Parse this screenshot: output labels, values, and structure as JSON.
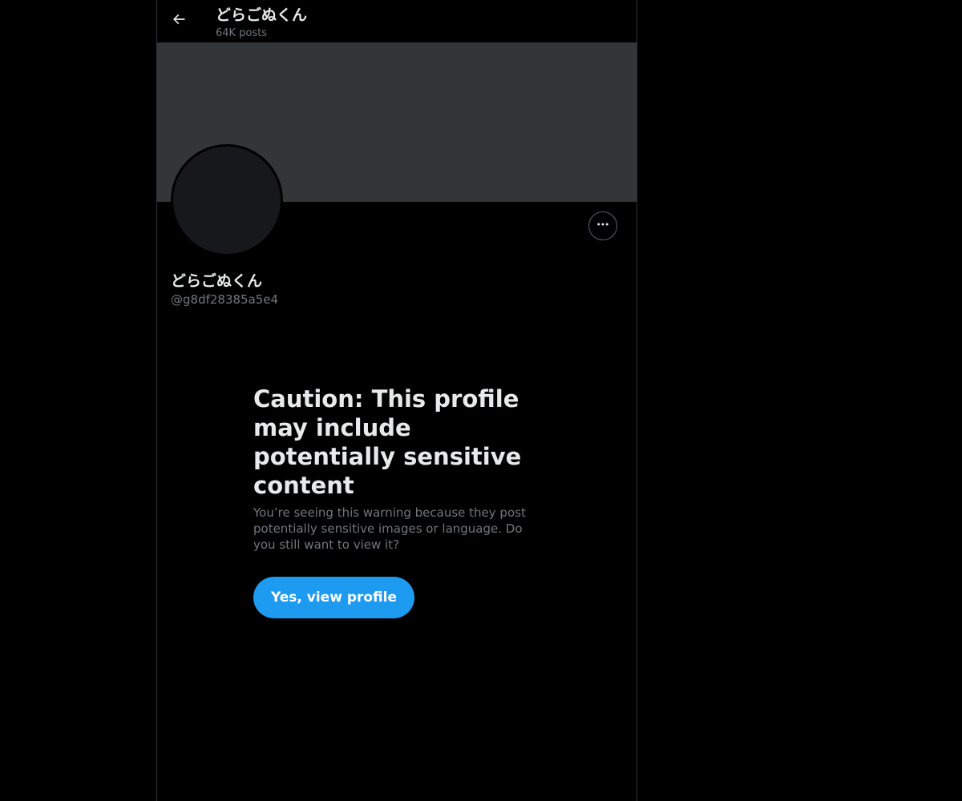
{
  "header": {
    "back_icon": "arrow-left-icon",
    "name": "どらごぬくん",
    "posts_count": "64K posts"
  },
  "profile": {
    "name": "どらごぬくん",
    "handle": "@g8df28385a5e4",
    "more_icon": "ellipsis-icon"
  },
  "warning": {
    "title": "Caution: This profile may include potentially sensitive content",
    "body": "You’re seeing this warning because they post potentially sensitive images or language. Do you still want to view it?",
    "button_label": "Yes, view profile"
  },
  "colors": {
    "background": "#000000",
    "banner": "#333639",
    "accent": "#1d9bf0",
    "secondary_text": "#71767b",
    "primary_text": "#e7e9ea"
  }
}
